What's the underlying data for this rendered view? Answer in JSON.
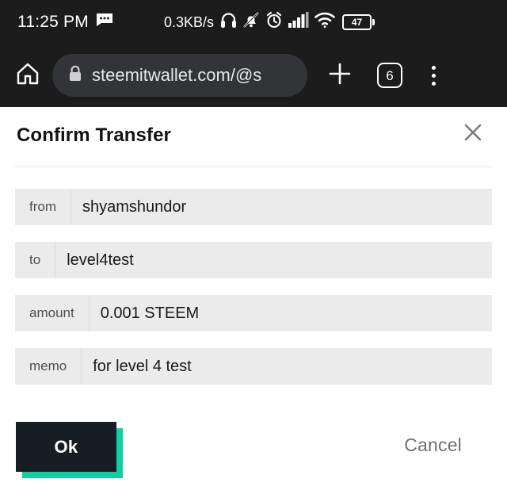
{
  "status_bar": {
    "clock": "11:25 PM",
    "message_icon": "message-bubble-icon",
    "network_speed": "0.3KB/s",
    "headphones_icon": "headphones-icon",
    "mute_icon": "bell-muted-icon",
    "alarm_icon": "alarm-clock-icon",
    "signal_icon": "cellular-signal-icon",
    "wifi_icon": "wifi-icon",
    "battery_level": "47"
  },
  "browser": {
    "home_icon": "home-icon",
    "lock_icon": "lock-icon",
    "url": "steemitwallet.com/@s",
    "new_tab_icon": "plus-icon",
    "tab_count": "6",
    "menu_icon": "overflow-menu-icon"
  },
  "dialog": {
    "title": "Confirm Transfer",
    "close_icon": "close-x-icon",
    "fields": [
      {
        "label": "from",
        "value": "shyamshundor"
      },
      {
        "label": "to",
        "value": "level4test"
      },
      {
        "label": "amount",
        "value": "0.001 STEEM"
      },
      {
        "label": "memo",
        "value": "for level 4 test"
      }
    ],
    "ok_label": "Ok",
    "cancel_label": "Cancel"
  },
  "colors": {
    "chrome_dark": "#1c1c1c",
    "omnibox_bg": "#333437",
    "field_bg": "#ebebeb",
    "ok_bg": "#171d25",
    "ok_accent": "#10cfa0",
    "cancel_text": "#6b7178"
  }
}
